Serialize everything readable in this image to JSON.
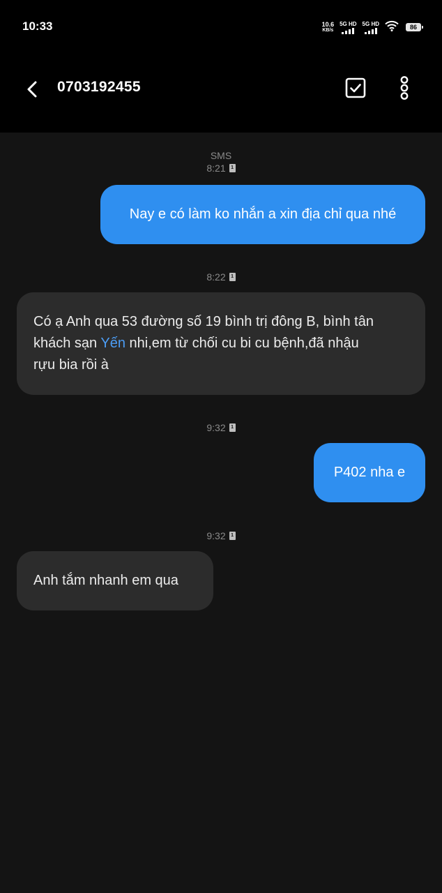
{
  "status_bar": {
    "time": "10:33",
    "net_speed": "10.6",
    "net_unit": "KB/s",
    "sim1_label": "5G HD",
    "sim2_label": "5G HD",
    "battery": "86"
  },
  "header": {
    "contact": "0703192455",
    "back_icon": "chevron-left-icon",
    "select_icon": "checkbox-icon",
    "more_icon": "more-vertical-icon"
  },
  "messages": [
    {
      "sms_label": "SMS",
      "time": "8:21",
      "sim": "1",
      "direction": "sent",
      "text": "Nay e có làm ko nhắn a xin địa chỉ qua nhé"
    },
    {
      "time": "8:22",
      "sim": "1",
      "direction": "received",
      "line1": "Có ạ Anh qua 53 đường số 19 bình trị đông B, bình tân",
      "line2_pre": "khách sạn ",
      "line2_link": "Yến",
      "line2_post": " nhi,em từ chối cu bi cu bệnh,đã nhậu",
      "line3": "rựu bia rồi à"
    },
    {
      "time": "9:32",
      "sim": "1",
      "direction": "sent",
      "text": "P402 nha e"
    },
    {
      "time": "9:32",
      "sim": "1",
      "direction": "received",
      "text": "Anh tắm nhanh em qua"
    }
  ],
  "colors": {
    "sent_bubble": "#2f8ff0",
    "received_bubble": "#2c2c2c",
    "link": "#4c9df5",
    "background": "#141414"
  }
}
